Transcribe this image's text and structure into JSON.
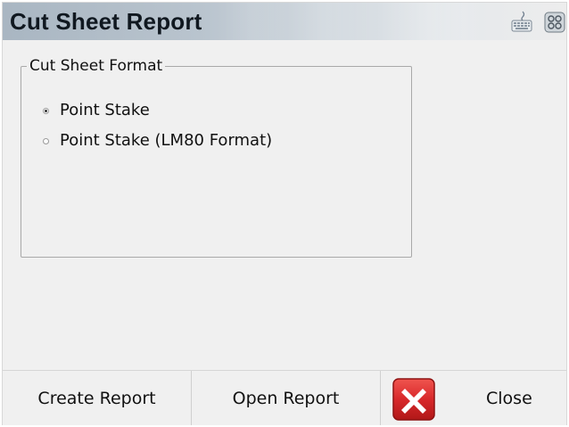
{
  "window": {
    "title": "Cut Sheet Report"
  },
  "titlebar_icons": {
    "keyboard": "keyboard-icon",
    "grid": "grid-menu-icon"
  },
  "format_group": {
    "legend": "Cut Sheet Format",
    "options": [
      {
        "label": "Point Stake",
        "selected": true
      },
      {
        "label": "Point Stake (LM80 Format)",
        "selected": false
      }
    ]
  },
  "buttons": {
    "create_report": "Create Report",
    "open_report": "Open Report",
    "close": "Close",
    "close_icon": "close-x-icon"
  },
  "colors": {
    "close_icon_red": "#d8282a",
    "background": "#f0f0f0"
  }
}
